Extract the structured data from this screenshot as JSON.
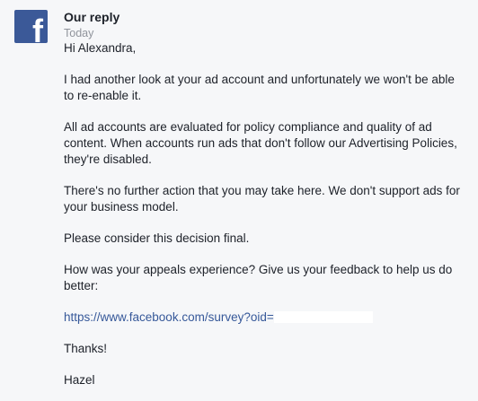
{
  "avatar": {
    "brand": "facebook",
    "color": "#3b5998",
    "icon": "facebook-f-icon"
  },
  "header": {
    "sender": "Our reply",
    "timestamp": "Today"
  },
  "message": {
    "greeting": "Hi Alexandra,",
    "paragraphs": [
      "I had another look at your ad account and unfortunately we won't be able to re-enable it.",
      "All ad accounts are evaluated for policy compliance and quality of ad content. When accounts run ads that don't follow our Advertising Policies, they're disabled.",
      "There's no further action that you may take here. We don't support ads for your business model.",
      "Please consider this decision final.",
      "How was your appeals experience? Give us your feedback to help us do better:"
    ],
    "survey_link": "https://www.facebook.com/survey?oid=",
    "thanks": "Thanks!",
    "signature": "Hazel"
  }
}
